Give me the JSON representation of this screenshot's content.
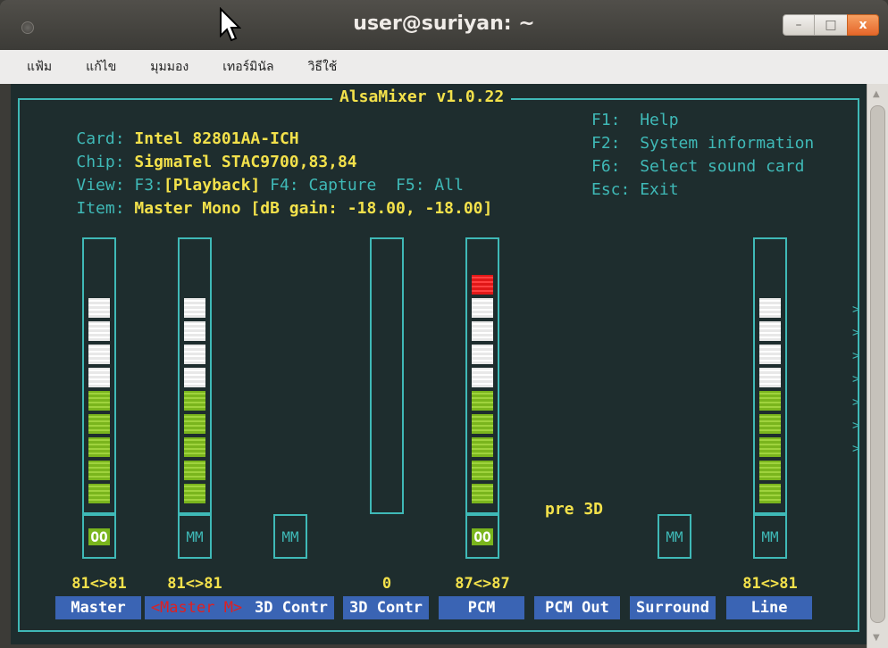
{
  "window": {
    "title": "user@suriyan: ~",
    "min_label": "–",
    "max_label": "□",
    "close_label": "x"
  },
  "menu": [
    "แฟ้ม",
    "แก้ไข",
    "มุมมอง",
    "เทอร์มินัล",
    "วิธีใช้"
  ],
  "mixer": {
    "title": "AlsaMixer v1.0.22",
    "card_key": "Card:",
    "card_val": "Intel 82801AA-ICH",
    "chip_key": "Chip:",
    "chip_val": "SigmaTel STAC9700,83,84",
    "view_key": "View:",
    "view_f3": "F3:",
    "view_playback": "[Playback]",
    "view_f4": "F4:",
    "view_capture": "Capture",
    "view_f5": "F5:",
    "view_all": "All",
    "item_key": "Item:",
    "item_val": "Master Mono [dB gain: -18.00, -18.00]",
    "help": [
      {
        "key": "F1:",
        "label": "Help"
      },
      {
        "key": "F2:",
        "label": "System information"
      },
      {
        "key": "F6:",
        "label": "Select sound card"
      },
      {
        "key": "Esc:",
        "label": "Exit"
      }
    ],
    "pre3d": "pre 3D",
    "channels": [
      {
        "label": "Master",
        "value": "81<>81",
        "level": 0.81,
        "mute": "OO",
        "selected": false
      },
      {
        "label": "<Master M>",
        "value": "81<>81",
        "level": 0.81,
        "mute": "MM",
        "selected": true
      },
      {
        "label": "3D Contr",
        "value": "",
        "level": null,
        "mute": "MM",
        "selected": false
      },
      {
        "label": "3D Contr",
        "value": "0",
        "level": 0,
        "mute": "",
        "selected": false
      },
      {
        "label": "PCM",
        "value": "87<>87",
        "level": 0.87,
        "mute": "OO",
        "selected": false
      },
      {
        "label": "PCM Out",
        "value": "",
        "level": null,
        "mute": "",
        "selected": false
      },
      {
        "label": "Surround",
        "value": "",
        "level": null,
        "mute": "MM",
        "selected": false
      },
      {
        "label": "Line",
        "value": "81<>81",
        "level": 0.81,
        "mute": "MM",
        "selected": false
      }
    ]
  },
  "colors": {
    "terminal_bg": "#1e2d2e",
    "cyan": "#3fb9b7",
    "yellow": "#f3e14b",
    "label_bg": "#3a64b4",
    "green": "#7ab51d",
    "red": "#e01818"
  }
}
